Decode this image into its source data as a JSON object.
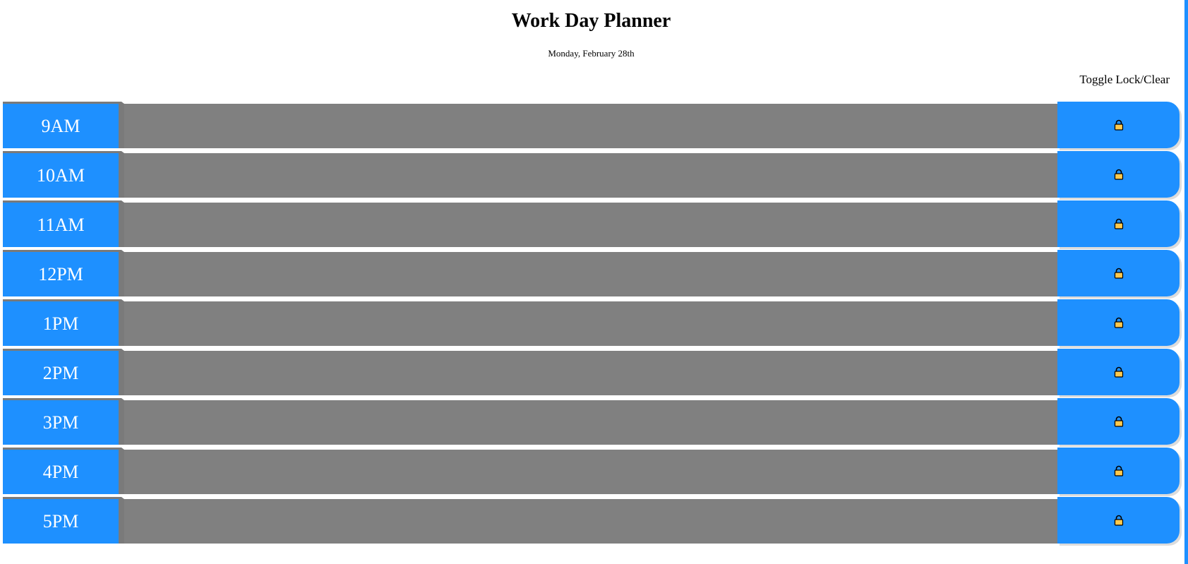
{
  "header": {
    "title": "Work Day Planner",
    "date": "Monday, February 28th",
    "toggle_label": "Toggle Lock/Clear"
  },
  "rows": [
    {
      "hour": "9AM",
      "task": "",
      "icon": "lock-icon"
    },
    {
      "hour": "10AM",
      "task": "",
      "icon": "lock-icon"
    },
    {
      "hour": "11AM",
      "task": "",
      "icon": "lock-icon"
    },
    {
      "hour": "12PM",
      "task": "",
      "icon": "lock-icon"
    },
    {
      "hour": "1PM",
      "task": "",
      "icon": "lock-icon"
    },
    {
      "hour": "2PM",
      "task": "",
      "icon": "lock-icon"
    },
    {
      "hour": "3PM",
      "task": "",
      "icon": "lock-icon"
    },
    {
      "hour": "4PM",
      "task": "",
      "icon": "lock-icon"
    },
    {
      "hour": "5PM",
      "task": "",
      "icon": "lock-icon"
    }
  ],
  "colors": {
    "hour_bg": "#1e90ff",
    "task_bg": "#808080",
    "lock_bg": "#1e90ff",
    "lock_icon": "#ffc94d"
  }
}
